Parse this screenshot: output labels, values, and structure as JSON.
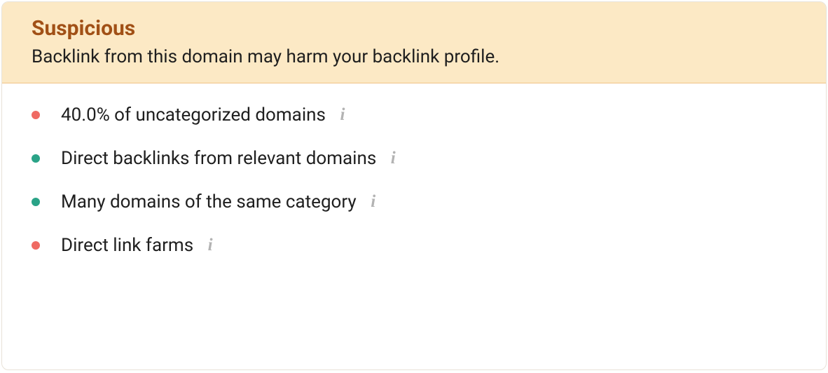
{
  "card": {
    "title": "Suspicious",
    "subtitle": "Backlink from this domain may harm your backlink profile.",
    "metrics": [
      {
        "label": "40.0% of uncategorized domains",
        "status": "red"
      },
      {
        "label": "Direct backlinks from relevant domains",
        "status": "green"
      },
      {
        "label": "Many domains of the same category",
        "status": "green"
      },
      {
        "label": "Direct link farms",
        "status": "red"
      }
    ],
    "info_glyph": "i"
  }
}
